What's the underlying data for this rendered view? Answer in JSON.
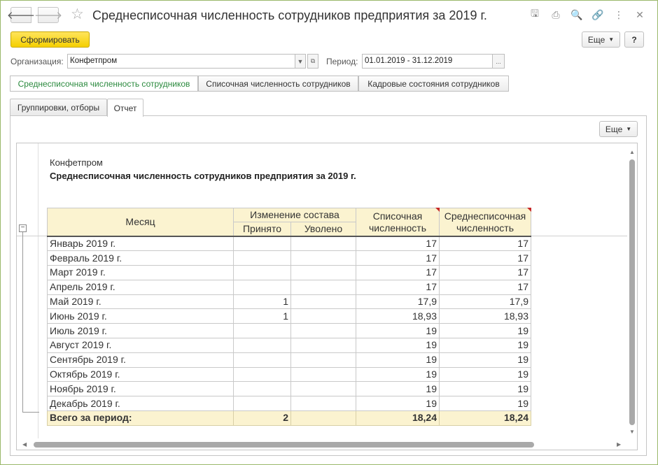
{
  "window": {
    "title": "Среднесписочная численность сотрудников предприятия за 2019 г.",
    "back_glyph": "🡐",
    "forward_glyph": "🡒",
    "star_glyph": "☆",
    "toolbar_icons": [
      "save-icon",
      "print-icon",
      "preview-icon",
      "link-icon",
      "more-vertical-icon",
      "close-icon"
    ],
    "toolbar_glyphs": [
      "🖫",
      "⎙",
      "🔍",
      "🔗",
      "⋮",
      "✕"
    ]
  },
  "command_bar": {
    "generate_label": "Сформировать",
    "more_label": "Еще",
    "help_label": "?"
  },
  "filters": {
    "org_label": "Организация:",
    "org_value": "Конфетпром",
    "period_label": "Период:",
    "period_value": "01.01.2019 - 31.12.2019",
    "ellipsis": "..."
  },
  "variants": [
    "Среднесписочная численность сотрудников",
    "Списочная численность сотрудников",
    "Кадровые состояния сотрудников"
  ],
  "tabs": [
    "Группировки, отборы",
    "Отчет"
  ],
  "report_panel": {
    "more_label": "Еще"
  },
  "report": {
    "organization": "Конфетпром",
    "title": "Среднесписочная численность сотрудников предприятия за 2019 г.",
    "headers": {
      "month": "Месяц",
      "change": "Изменение состава",
      "hired": "Принято",
      "fired": "Уволено",
      "list_count": "Списочная численность",
      "avg_count": "Среднесписочная численность"
    },
    "rows": [
      {
        "month": "Январь 2019 г.",
        "hired": "",
        "fired": "",
        "list": "17",
        "avg": "17"
      },
      {
        "month": "Февраль 2019 г.",
        "hired": "",
        "fired": "",
        "list": "17",
        "avg": "17"
      },
      {
        "month": "Март 2019 г.",
        "hired": "",
        "fired": "",
        "list": "17",
        "avg": "17"
      },
      {
        "month": "Апрель 2019 г.",
        "hired": "",
        "fired": "",
        "list": "17",
        "avg": "17"
      },
      {
        "month": "Май 2019 г.",
        "hired": "1",
        "fired": "",
        "list": "17,9",
        "avg": "17,9"
      },
      {
        "month": "Июнь 2019 г.",
        "hired": "1",
        "fired": "",
        "list": "18,93",
        "avg": "18,93"
      },
      {
        "month": "Июль 2019 г.",
        "hired": "",
        "fired": "",
        "list": "19",
        "avg": "19"
      },
      {
        "month": "Август 2019 г.",
        "hired": "",
        "fired": "",
        "list": "19",
        "avg": "19"
      },
      {
        "month": "Сентябрь 2019 г.",
        "hired": "",
        "fired": "",
        "list": "19",
        "avg": "19"
      },
      {
        "month": "Октябрь 2019 г.",
        "hired": "",
        "fired": "",
        "list": "19",
        "avg": "19"
      },
      {
        "month": "Ноябрь 2019 г.",
        "hired": "",
        "fired": "",
        "list": "19",
        "avg": "19"
      },
      {
        "month": "Декабрь 2019 г.",
        "hired": "",
        "fired": "",
        "list": "19",
        "avg": "19"
      }
    ],
    "total": {
      "label": "Всего за период:",
      "hired": "2",
      "fired": "",
      "list": "18,24",
      "avg": "18,24"
    }
  }
}
